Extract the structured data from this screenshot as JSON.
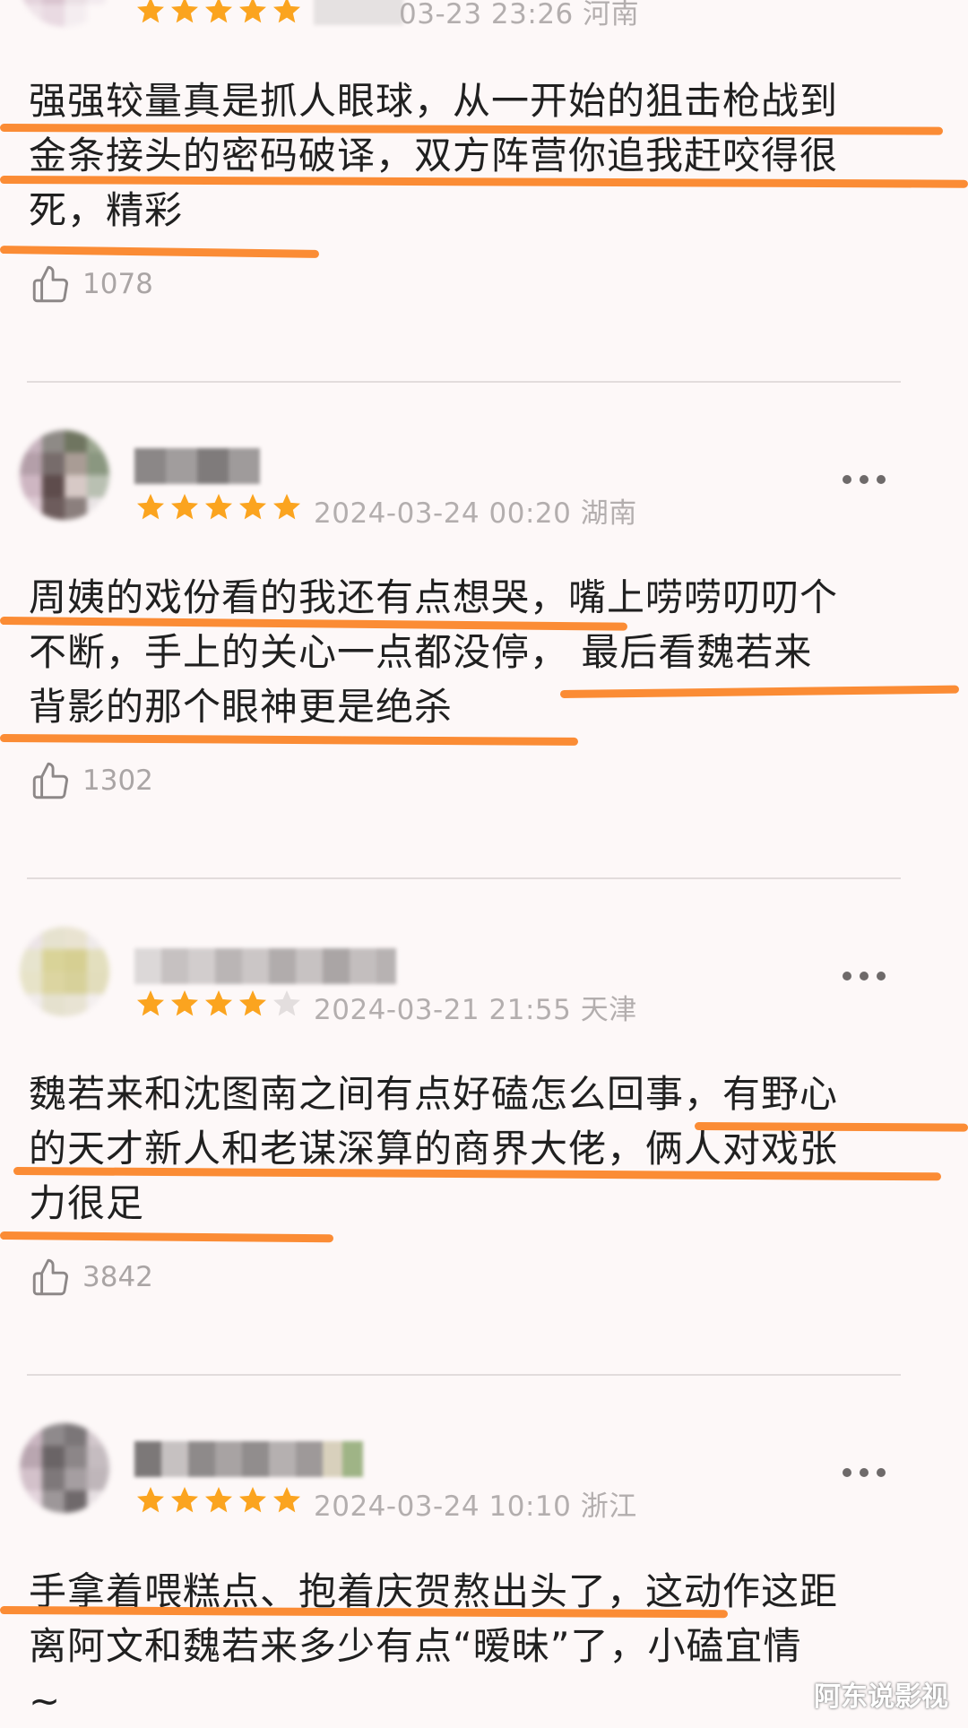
{
  "reviews": [
    {
      "rating": 5,
      "date": "03-23 23:26",
      "location": "河南",
      "lines": [
        "强强较量真是抓人眼球，从一开始的狙击枪战到",
        "金条接头的密码破译，双方阵营你追我赶咬得很",
        "死，精彩"
      ],
      "likes": "1078"
    },
    {
      "rating": 5,
      "date": "2024-03-24 00:20",
      "location": "湖南",
      "lines": [
        "周姨的戏份看的我还有点想哭，嘴上唠唠叨叨个",
        "不断，手上的关心一点都没停， 最后看魏若来",
        "背影的那个眼神更是绝杀"
      ],
      "likes": "1302"
    },
    {
      "rating": 4,
      "date": "2024-03-21 21:55",
      "location": "天津",
      "lines": [
        "魏若来和沈图南之间有点好磕怎么回事，有野心",
        "的天才新人和老谋深算的商界大佬，俩人对戏张",
        "力很足"
      ],
      "likes": "3842"
    },
    {
      "rating": 5,
      "date": "2024-03-24 10:10",
      "location": "浙江",
      "lines": [
        "手拿着喂糕点、抱着庆贺熬出头了，这动作这距",
        "离阿文和魏若来多少有点“暧昧”了，小磕宜情",
        "~"
      ],
      "likes": ""
    }
  ],
  "icons": {
    "like": "thumbs-up-icon",
    "more": "more-dots-icon",
    "star": "star-icon"
  },
  "colors": {
    "highlight": "#fb8c35",
    "star_filled": "#fba41f",
    "star_empty": "#e3dede"
  },
  "watermark": "阿东说影视"
}
